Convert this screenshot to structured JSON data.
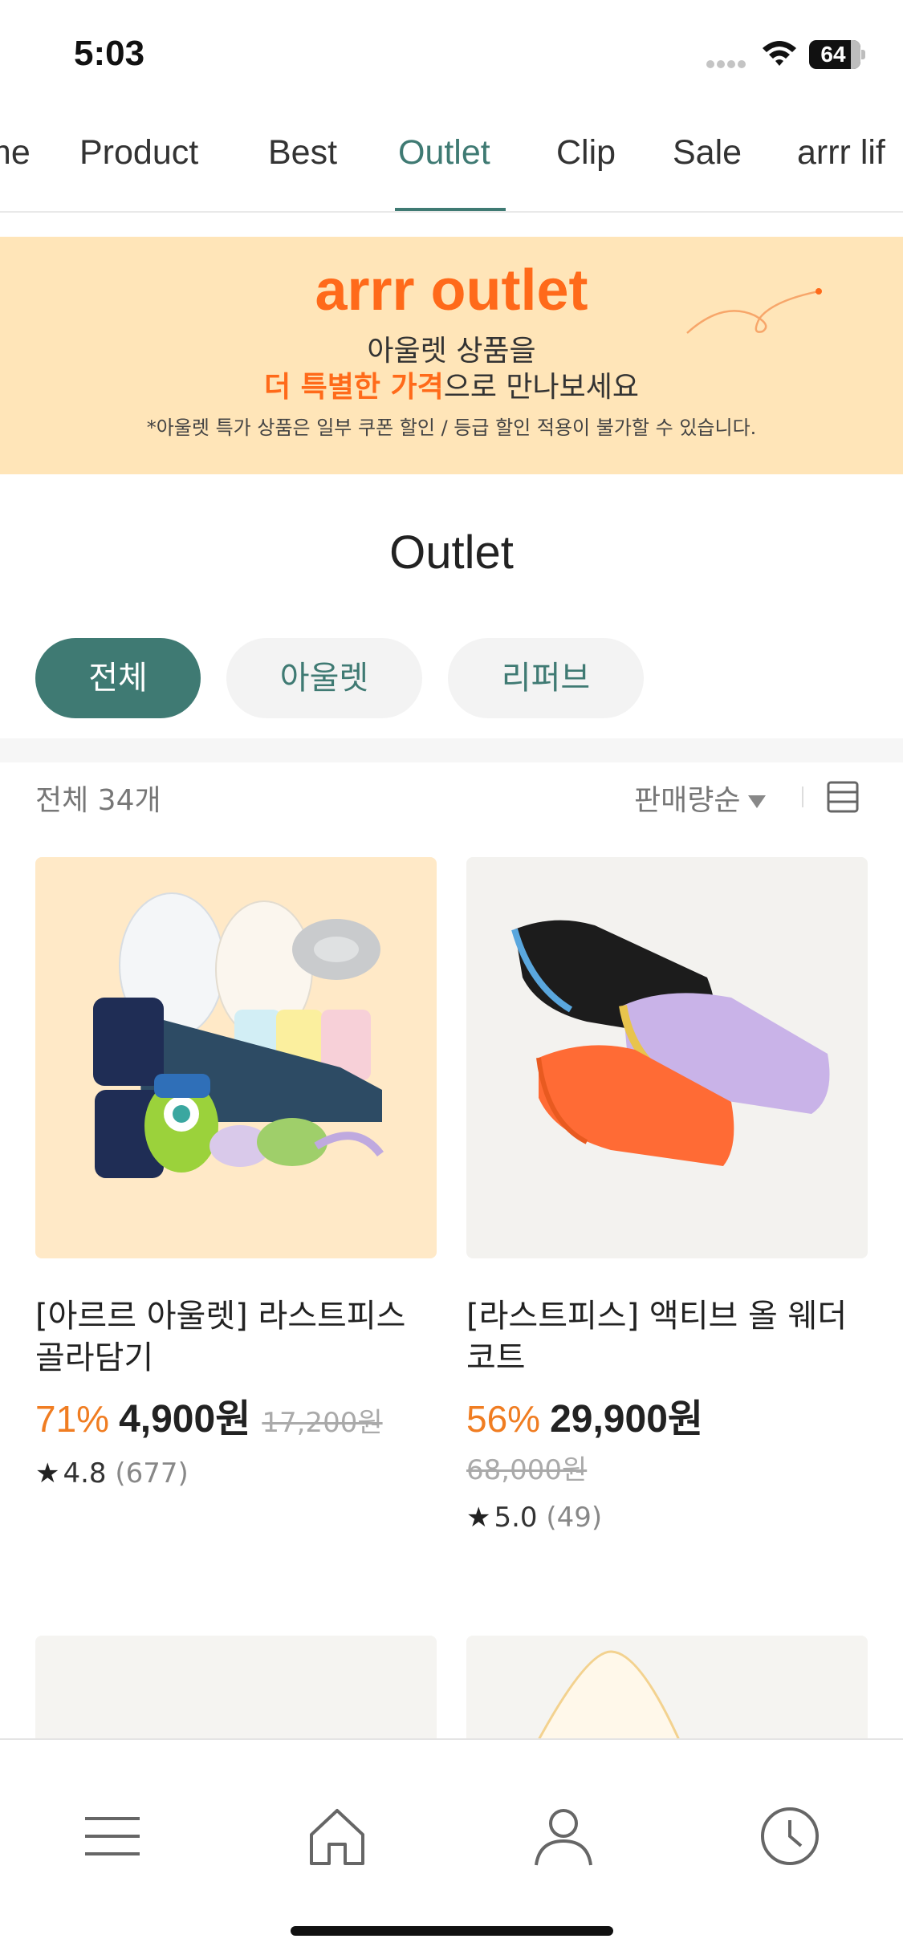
{
  "status_bar": {
    "time": "5:03",
    "battery": "64"
  },
  "tabs": [
    {
      "label": "me"
    },
    {
      "label": "Product"
    },
    {
      "label": "Best"
    },
    {
      "label": "Outlet"
    },
    {
      "label": "Clip"
    },
    {
      "label": "Sale"
    },
    {
      "label": "arrr lif"
    }
  ],
  "active_tab": "Outlet",
  "banner": {
    "title": "arrr outlet",
    "line1": "아울렛 상품을",
    "line2_highlight": "더 특별한 가격",
    "line2_rest": "으로 만나보세요",
    "note": "*아울렛 특가 상품은 일부 쿠폰 할인 / 등급 할인 적용이 불가할 수 있습니다."
  },
  "section_title": "Outlet",
  "chips": {
    "all": "전체",
    "outlet": "아울렛",
    "refurb": "리퍼브"
  },
  "list_header": {
    "total": "전체 34개",
    "sort": "판매량순"
  },
  "products": [
    {
      "name": "[아르르 아울렛] 라스트피스 골라담기",
      "discount": "71%",
      "price": "4,900원",
      "original_price": "17,200원",
      "rating": "4.8",
      "reviews": "(677)"
    },
    {
      "name": "[라스트피스] 액티브 올 웨더 코트",
      "discount": "56%",
      "price": "29,900원",
      "original_price": "68,000원",
      "rating": "5.0",
      "reviews": "(49)"
    }
  ],
  "icons": {
    "star": "★",
    "nav": [
      "menu-icon",
      "home-icon",
      "user-icon",
      "clock-icon"
    ]
  },
  "colors": {
    "accent": "#3f7a73",
    "orange": "#ff6a1a",
    "discount": "#f07d22",
    "banner_bg": "#ffe5b8"
  }
}
